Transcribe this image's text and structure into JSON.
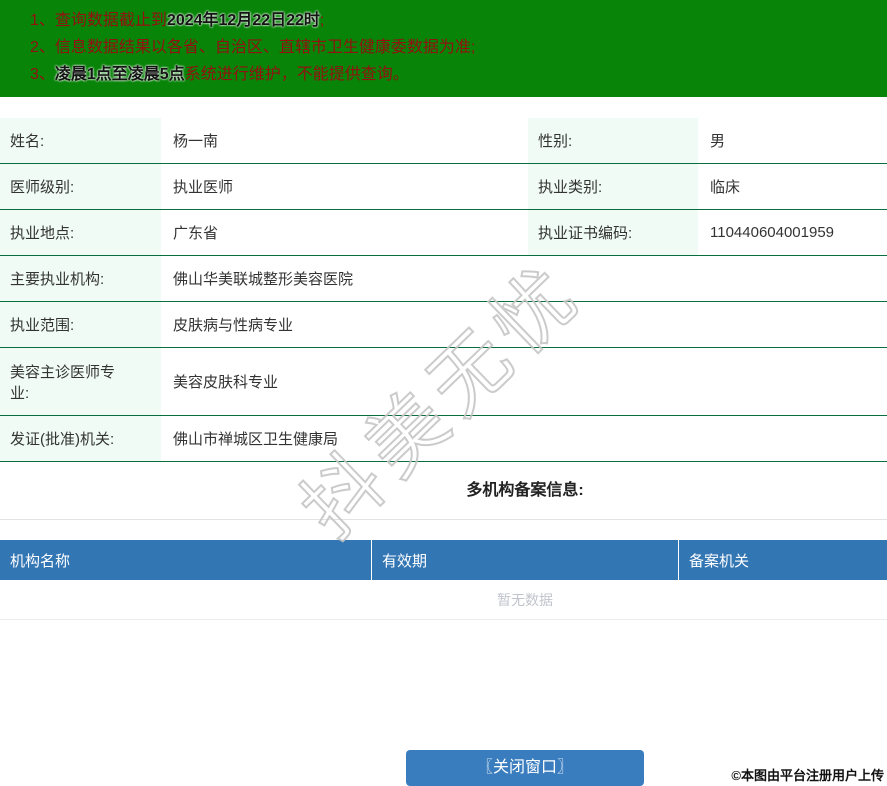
{
  "banner": {
    "notices": [
      {
        "num": "1、",
        "pre": "查询数据截止到",
        "bold": "2024年12月22日22时",
        "post": ";"
      },
      {
        "num": "2、",
        "pre": "信息数据结果以各省、自治区、直辖市卫生健康委数据为准;",
        "bold": "",
        "post": ""
      },
      {
        "num": "3、",
        "pre": "",
        "bold": "凌晨1点至凌晨5点",
        "post": "系统进行维护，不能提供查询。"
      }
    ]
  },
  "info_table": {
    "rows": [
      {
        "cells": [
          {
            "label": "姓名:",
            "value": "杨一南"
          },
          {
            "label": "性别:",
            "value": "男"
          }
        ]
      },
      {
        "cells": [
          {
            "label": "医师级别:",
            "value": "执业医师"
          },
          {
            "label": "执业类别:",
            "value": "临床"
          }
        ]
      },
      {
        "cells": [
          {
            "label": "执业地点:",
            "value": "广东省"
          },
          {
            "label": "执业证书编码:",
            "value": "110440604001959"
          }
        ]
      },
      {
        "cells": [
          {
            "label": "主要执业机构:",
            "value": "佛山华美联城整形美容医院"
          }
        ]
      },
      {
        "cells": [
          {
            "label": "执业范围:",
            "value": "皮肤病与性病专业"
          }
        ]
      },
      {
        "cells": [
          {
            "label": "美容主诊医师专\n业:",
            "value": "美容皮肤科专业"
          }
        ],
        "tall": true
      },
      {
        "cells": [
          {
            "label": "发证(批准)机关:",
            "value": "佛山市禅城区卫生健康局"
          }
        ]
      }
    ]
  },
  "section": {
    "title": "多机构备案信息:"
  },
  "record_table": {
    "headers": [
      "机构名称",
      "有效期",
      "备案机关"
    ],
    "empty_text": "暂无数据"
  },
  "actions": {
    "close_button": "〖关闭窗口〗"
  },
  "watermark": {
    "text": "抖美无忧"
  },
  "footer": {
    "copyright": "©本图由平台注册用户上传"
  },
  "colors": {
    "banner_bg": "#088408",
    "notice_red": "#931111",
    "notice_bold": "#141414",
    "label_bg": "#effbf4",
    "divider_green": "#086e3e",
    "table_header_bg": "#3376b4",
    "button_bg": "#3a7dbf",
    "empty_text": "#c0c4cc"
  }
}
